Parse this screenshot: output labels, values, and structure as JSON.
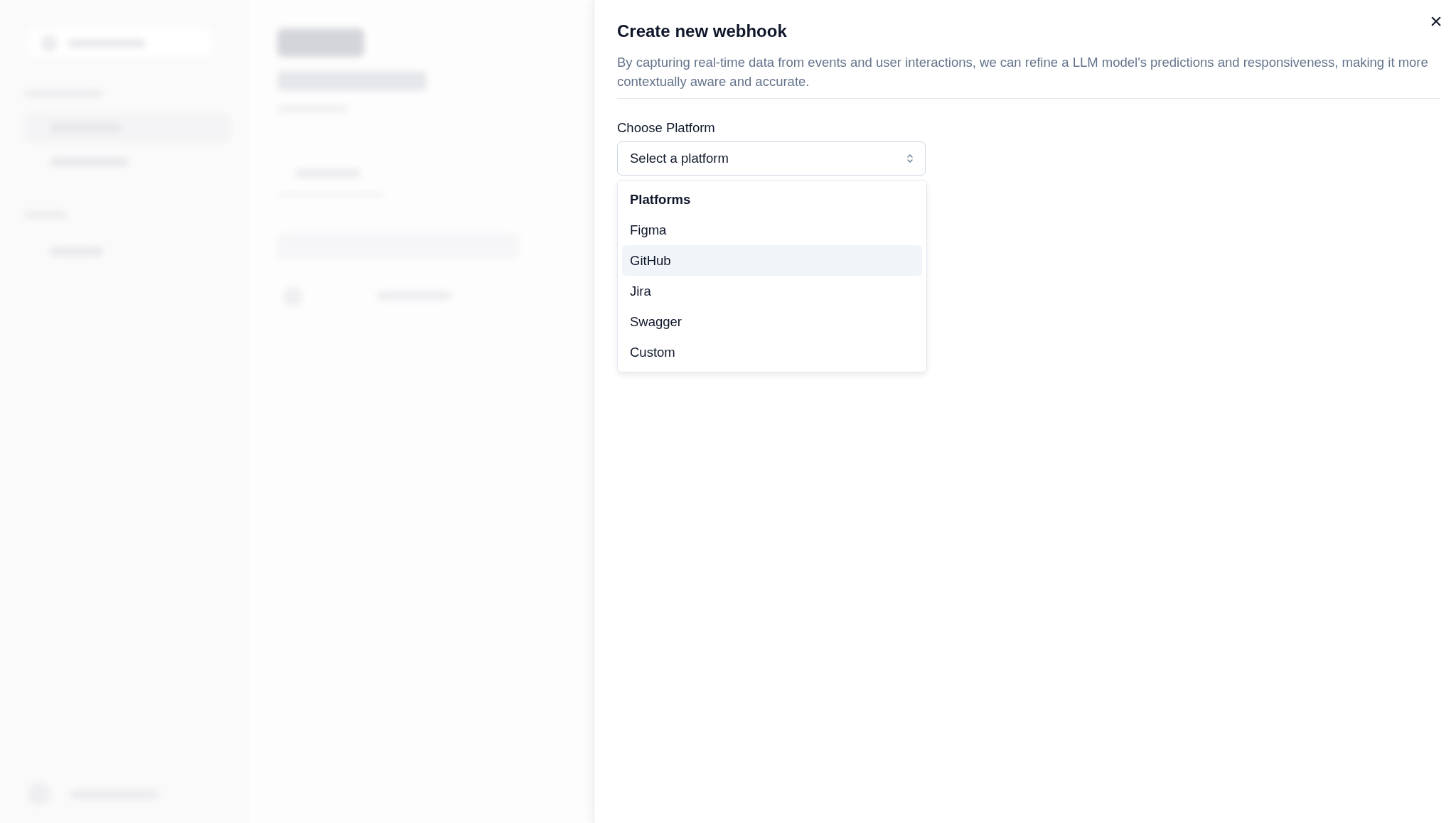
{
  "sheet": {
    "title": "Create new webhook",
    "description": "By capturing real-time data from events and user interactions, we can refine a LLM model's predictions and responsiveness, making it more contextually aware and accurate.",
    "close": "×"
  },
  "platform_field": {
    "label": "Choose Platform",
    "placeholder": "Select a platform",
    "expanded": true
  },
  "dropdown": {
    "group_label": "Platforms",
    "options": [
      {
        "label": "Figma",
        "highlighted": false
      },
      {
        "label": "GitHub",
        "highlighted": true
      },
      {
        "label": "Jira",
        "highlighted": false
      },
      {
        "label": "Swagger",
        "highlighted": false
      },
      {
        "label": "Custom",
        "highlighted": false
      }
    ]
  }
}
